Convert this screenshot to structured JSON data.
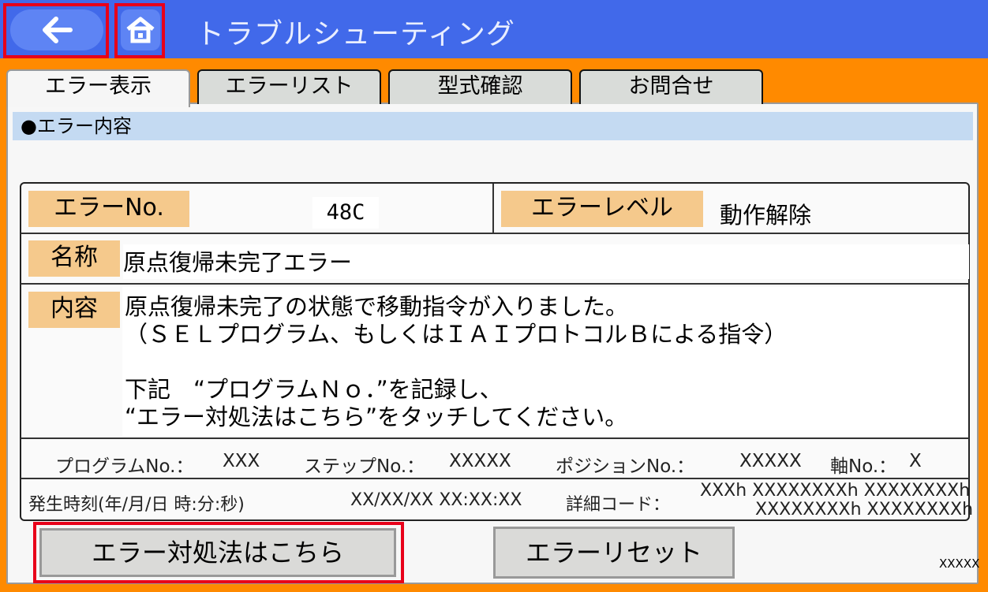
{
  "header": {
    "title": "トラブルシューティング",
    "back_icon": "arrow-left-icon",
    "home_icon": "home-icon",
    "accent_color": "#4169ea",
    "highlight_color": "#e8001a"
  },
  "tabs": [
    {
      "label": "エラー表示",
      "active": true
    },
    {
      "label": "エラーリスト",
      "active": false
    },
    {
      "label": "型式確認",
      "active": false
    },
    {
      "label": "お問合せ",
      "active": false
    }
  ],
  "section": {
    "title": "●エラー内容"
  },
  "error": {
    "no_label": "エラーNo.",
    "no_value": "48C",
    "level_label": "エラーレベル",
    "level_value": "動作解除",
    "name_label": "名称",
    "name_value": "原点復帰未完了エラー",
    "content_label": "内容",
    "content_lines": [
      "原点復帰未完了の状態で移動指令が入りました。",
      "（ＳＥＬプログラム、もしくはＩＡＩプロトコルＢによる指令）",
      "",
      "下記　“プログラムＮｏ．”を記録し、",
      "“エラー対処法はこちら”をタッチしてください。"
    ]
  },
  "info": {
    "program_label": "プログラムNo.：",
    "program_value": "XXX",
    "step_label": "ステップNo.：",
    "step_value": "XXXXX",
    "position_label": "ポジションNo.：",
    "position_value": "XXXXX",
    "axis_label": "軸No.：",
    "axis_value": "X",
    "time_label": "発生時刻(年/月/日 時:分:秒)",
    "time_value": "XX/XX/XX XX:XX:XX",
    "detail_label": "詳細コード：",
    "detail_line1": "XXXh XXXXXXXXh XXXXXXXXh",
    "detail_line2": "XXXXXXXXh XXXXXXXXh"
  },
  "buttons": {
    "guide": "エラー対処法はこちら",
    "reset": "エラーリセット"
  },
  "footer_code": "XXXXX"
}
